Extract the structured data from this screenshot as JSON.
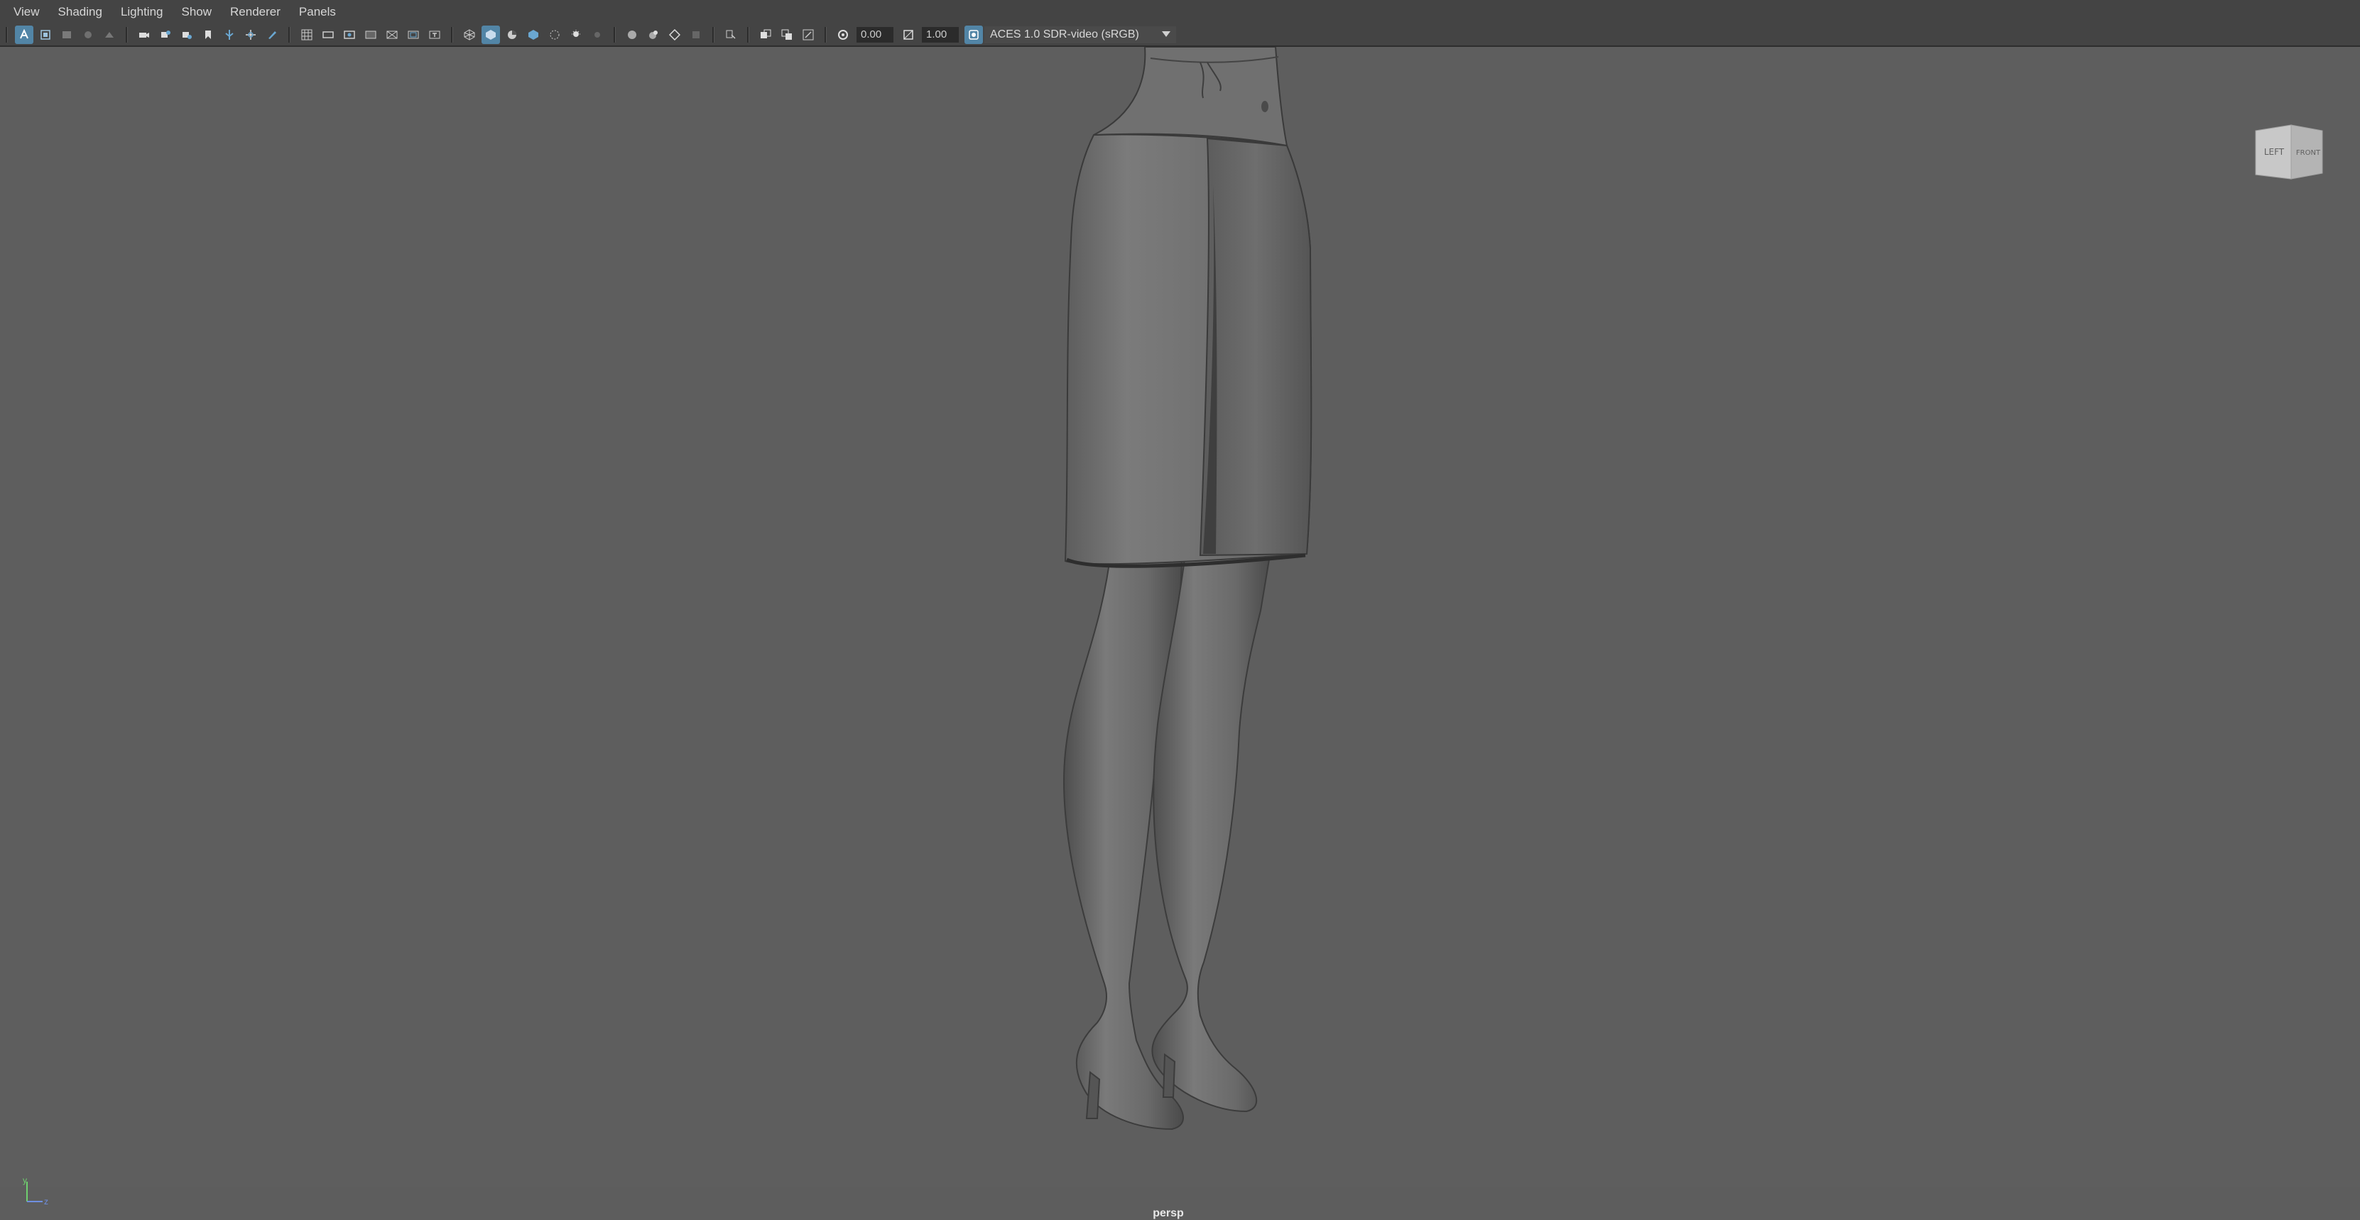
{
  "menubar": {
    "items": [
      "View",
      "Shading",
      "Lighting",
      "Show",
      "Renderer",
      "Panels"
    ]
  },
  "toolbar": {
    "exposure_value": "0.00",
    "gamma_value": "1.00",
    "color_space": "ACES 1.0 SDR-video (sRGB)",
    "icons": [
      "select-camera-icon",
      "camera-attributes-icon",
      "bookmarks-icon",
      "image-plane-icon",
      "2d-pan-zoom-icon",
      "grease-pencil-icon",
      "grid-icon",
      "film-gate-icon",
      "resolution-gate-icon",
      "gate-mask-icon",
      "field-chart-icon",
      "safe-action-icon",
      "safe-title-icon",
      "wireframe-icon",
      "smooth-shade-icon",
      "default-material-icon",
      "textured-icon",
      "use-all-lights-icon",
      "shadows-icon",
      "ambient-occlusion-icon",
      "motion-blur-icon",
      "anti-aliasing-icon",
      "depth-of-field-icon",
      "isolate-select-icon",
      "xray-icon",
      "xray-active-icon",
      "xray-joints-icon",
      "exposure-icon",
      "gamma-icon",
      "color-management-icon"
    ]
  },
  "viewport": {
    "camera_name": "persp",
    "viewcube": {
      "left": "LEFT",
      "front": "FRONT"
    },
    "axis": {
      "y": "y",
      "z": "z"
    }
  },
  "colors": {
    "viewport_bg": "#5e5e5e",
    "ui_bg": "#444444",
    "accent": "#5285a6",
    "model": "#6f6f6f"
  }
}
